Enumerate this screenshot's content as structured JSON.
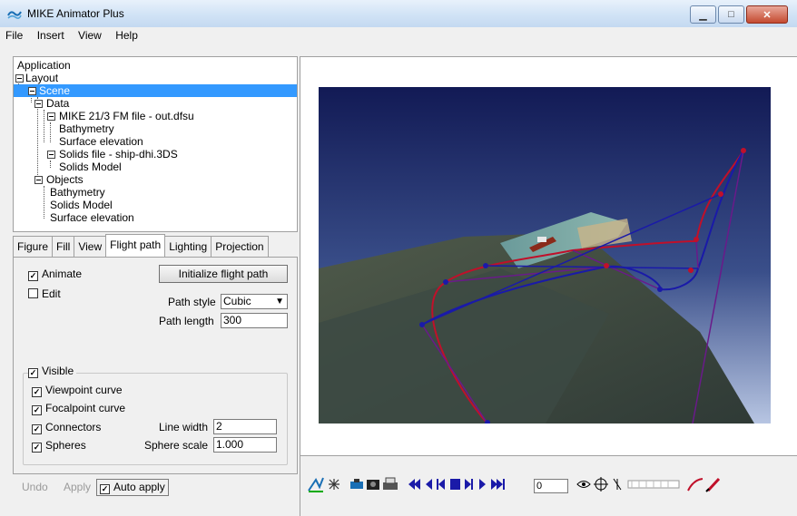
{
  "window": {
    "title": "MIKE Animator Plus",
    "buttons": [
      "minimize",
      "maximize",
      "close"
    ]
  },
  "menu": [
    "File",
    "Insert",
    "View",
    "Help"
  ],
  "tree": {
    "items": [
      {
        "label": "Application"
      },
      {
        "label": "Layout"
      },
      {
        "label": "Scene",
        "selected": true
      },
      {
        "label": "Data"
      },
      {
        "label": "MIKE 21/3 FM file - out.dfsu"
      },
      {
        "label": "Bathymetry"
      },
      {
        "label": "Surface elevation"
      },
      {
        "label": "Solids file - ship-dhi.3DS"
      },
      {
        "label": "Solids Model"
      },
      {
        "label": "Objects"
      },
      {
        "label": "Bathymetry"
      },
      {
        "label": "Solids Model"
      },
      {
        "label": "Surface elevation"
      }
    ]
  },
  "tabs": [
    "Figure",
    "Fill",
    "View",
    "Flight path",
    "Lighting",
    "Projection"
  ],
  "active_tab": "Flight path",
  "flight_path": {
    "animate_label": "Animate",
    "animate_checked": true,
    "edit_label": "Edit",
    "edit_checked": false,
    "init_button": "Initialize flight path",
    "path_style_label": "Path style",
    "path_style_value": "Cubic",
    "path_length_label": "Path length",
    "path_length_value": "300",
    "visible_label": "Visible",
    "viewpoint_label": "Viewpoint curve",
    "focalpoint_label": "Focalpoint curve",
    "connectors_label": "Connectors",
    "spheres_label": "Spheres",
    "line_width_label": "Line width",
    "line_width_value": "2",
    "sphere_scale_label": "Sphere scale",
    "sphere_scale_value": "1.000"
  },
  "footer": {
    "undo": "Undo",
    "apply": "Apply",
    "auto_apply": "Auto apply"
  },
  "toolbar": {
    "frame_value": "0"
  },
  "colors": {
    "selection": "#3399ff",
    "viewpoint_curve": "#c0102a",
    "focalpoint_curve": "#1a1aa8",
    "connector": "#6a1a8a"
  }
}
